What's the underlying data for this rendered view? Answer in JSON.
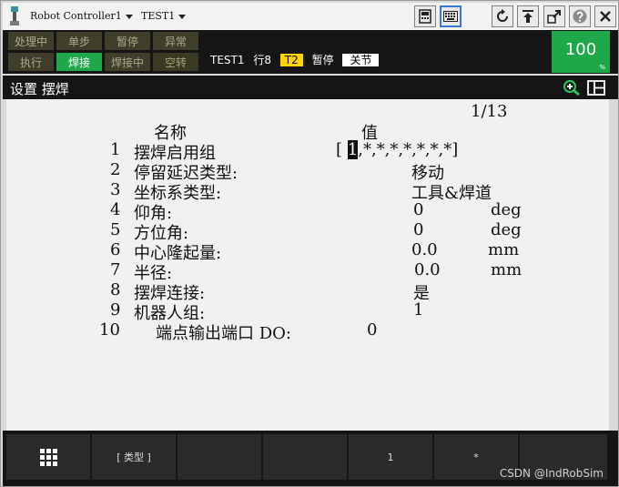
{
  "titlebar": {
    "controller": "Robot Controller1",
    "program": "TEST1",
    "icons": [
      "teach-pendant-icon",
      "keyboard-icon",
      "rotate-icon",
      "arrow-top-icon",
      "window-arrow-icon",
      "help-icon",
      "close-icon"
    ]
  },
  "status": {
    "leds": [
      {
        "label": "处理中",
        "state": "off"
      },
      {
        "label": "单步",
        "state": "off"
      },
      {
        "label": "暂停",
        "state": "off"
      },
      {
        "label": "异常",
        "state": "off"
      },
      {
        "label": "执行",
        "state": "off"
      },
      {
        "label": "焊接",
        "state": "on"
      },
      {
        "label": "焊接中",
        "state": "off"
      },
      {
        "label": "空转",
        "state": "off"
      }
    ],
    "program": "TEST1",
    "line": "行8",
    "mode": "T2",
    "state": "暂停",
    "switch": "关节",
    "override": "100",
    "override_unit": "%",
    "colors": {
      "green": "#1fa84a",
      "yellow": "#ffd400"
    }
  },
  "screen": {
    "title": "设置 摆焊",
    "icons": [
      "zoom-in-icon",
      "split-window-icon"
    ]
  },
  "content": {
    "page": "1/13",
    "header_name": "名称",
    "header_value": "值",
    "rows": [
      {
        "num": "1",
        "label": "摆焊启用组",
        "value": "",
        "unit": ""
      },
      {
        "num": "2",
        "label": "停留延迟类型:",
        "value": "移动",
        "unit": ""
      },
      {
        "num": "3",
        "label": "坐标系类型:",
        "value": "工具&焊道",
        "unit": ""
      },
      {
        "num": "4",
        "label": "仰角:",
        "value": "0",
        "unit": "deg"
      },
      {
        "num": "5",
        "label": "方位角:",
        "value": "0",
        "unit": "deg"
      },
      {
        "num": "6",
        "label": "中心隆起量:",
        "value": "0.0",
        "unit": "mm"
      },
      {
        "num": "7",
        "label": "半径:",
        "value": "0.0",
        "unit": "mm"
      },
      {
        "num": "8",
        "label": "摆焊连接:",
        "value": "是",
        "unit": ""
      },
      {
        "num": "9",
        "label": "机器人组:",
        "value": "1",
        "unit": ""
      },
      {
        "num": "10",
        "label": "端点输出端口 DO:",
        "value": "0",
        "unit": ""
      }
    ],
    "group_mask": {
      "open": "[",
      "cursor": "1",
      "rest": ",*,*,*,*,*,*,*",
      "close": "]"
    }
  },
  "fkeys": [
    "",
    "[ 类型 ]",
    "",
    "",
    "1",
    "*",
    ""
  ],
  "watermark": "CSDN @IndRobSim"
}
